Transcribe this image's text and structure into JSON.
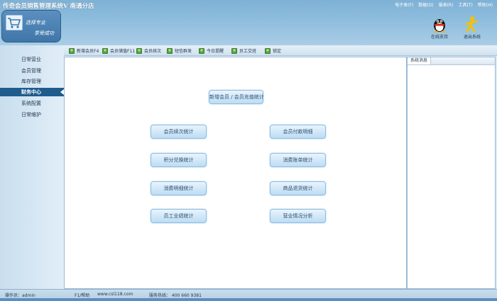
{
  "app": {
    "title": "传奇会员销售管理系统V 南通分店"
  },
  "top_menu": [
    "电子表(F)",
    "数据(D)",
    "报表(R)",
    "工具(T)",
    "帮助(H)"
  ],
  "logo": {
    "slogan_line1": "选择专业",
    "slogan_line2": "享受成功"
  },
  "header_buttons": {
    "online_service": {
      "label": "在线支持",
      "icon": "qq-penguin-icon"
    },
    "exit_system": {
      "label": "退出系统",
      "icon": "exit-runner-icon"
    }
  },
  "sidebar": {
    "items": [
      {
        "label": "日常营业",
        "active": false
      },
      {
        "label": "会员管理",
        "active": false
      },
      {
        "label": "库存管理",
        "active": false
      },
      {
        "label": "财务中心",
        "active": true
      },
      {
        "label": "系统配置",
        "active": false
      },
      {
        "label": "日常维护",
        "active": false
      }
    ]
  },
  "toolbar": {
    "items": [
      {
        "label": "新增会员F4",
        "icon": "plus-icon"
      },
      {
        "label": "会员储值F11",
        "icon": "plus-icon"
      },
      {
        "label": "会员续次",
        "icon": "plus-icon"
      },
      {
        "label": "短信群发",
        "icon": "plus-icon"
      },
      {
        "label": "今日提醒",
        "icon": "plus-icon"
      },
      {
        "label": "员工交班",
        "icon": "plus-icon"
      },
      {
        "label": "锁定",
        "icon": "plus-icon"
      }
    ]
  },
  "main": {
    "buttons": {
      "new_member_stats": "新增会员 / 会员充值统计",
      "member_visit_stats": "会员续次统计",
      "member_payment_detail": "会员付款明细",
      "points_exchange_stats": "积分兑换统计",
      "consumption_bill_stats": "消费账单统计",
      "consumption_detail_stats": "消费明细统计",
      "product_return_stats": "商品退货统计",
      "staff_performance_stats": "员工业绩统计",
      "business_analysis": "营业情况分析"
    }
  },
  "right_panel": {
    "tab_label": "系统消息"
  },
  "statusbar": {
    "operator": "操作员：admin",
    "help": "F1/帮助",
    "website": "www.csl118.com",
    "hotline": "服务热线： 400 660 9381"
  },
  "colors": {
    "header": "#8cbcdc",
    "active_nav": "#1f5c8e",
    "button_border": "#8fbde0",
    "toolbar_icon": "#5aa63e"
  }
}
